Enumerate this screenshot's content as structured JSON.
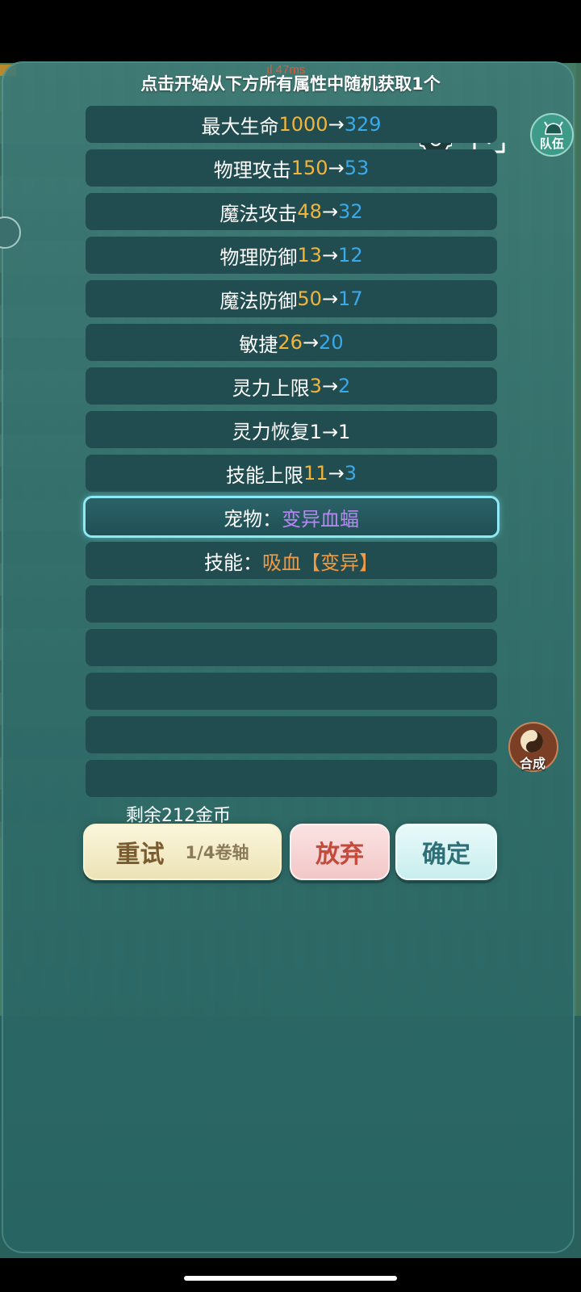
{
  "status": {
    "ping": "ıl 47ms"
  },
  "title": "点击开始从下方所有属性中随机获取1个",
  "attributes": [
    {
      "name": "最大生命",
      "from": "1000",
      "to": "329"
    },
    {
      "name": "物理攻击",
      "from": "150",
      "to": "53"
    },
    {
      "name": "魔法攻击",
      "from": "48",
      "to": "32"
    },
    {
      "name": "物理防御",
      "from": "13",
      "to": "12"
    },
    {
      "name": "魔法防御",
      "from": "50",
      "to": "17"
    },
    {
      "name": "敏捷",
      "from": "26",
      "to": "20"
    },
    {
      "name": "灵力上限",
      "from": "3",
      "to": "2"
    },
    {
      "name": "灵力恢复1→1"
    },
    {
      "name": "技能上限",
      "from": "11",
      "to": "3"
    }
  ],
  "pet": {
    "label": "宠物：",
    "value": "变异血蝠"
  },
  "skill": {
    "label": "技能：",
    "value": "吸血【变异】"
  },
  "arrow": "→",
  "side_buttons": {
    "team": "队伍",
    "craft": "合成"
  },
  "gold_remaining": "剩余212金币",
  "buttons": {
    "retry": "重试",
    "retry_scrolls": "1/4卷轴",
    "quit": "放弃",
    "confirm": "确定"
  },
  "icons": [
    "gear-icon",
    "download-icon",
    "team-helmet-icon",
    "yin-yang-icon"
  ],
  "colors": {
    "old_value": "#f3b43a",
    "new_value": "#3aa9ea",
    "pet": "#b788f2",
    "skill": "#f09a45",
    "selected_glow": "#8fe8f5"
  }
}
